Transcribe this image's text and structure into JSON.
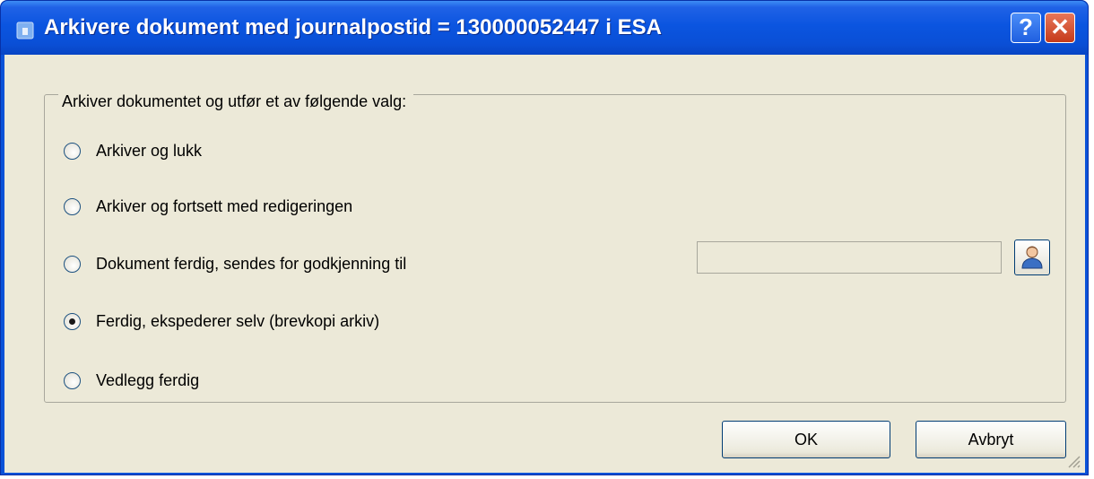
{
  "window": {
    "title": "Arkivere dokument med journalpostid = 130000052447 i ESA",
    "help_label": "?",
    "close_label": "✕"
  },
  "group": {
    "legend": "Arkiver dokumentet og utfør et av følgende valg:"
  },
  "options": [
    {
      "label": "Arkiver og lukk",
      "checked": false
    },
    {
      "label": "Arkiver og fortsett med redigeringen",
      "checked": false
    },
    {
      "label": "Dokument ferdig, sendes for godkjenning til",
      "checked": false
    },
    {
      "label": "Ferdig, ekspederer selv (brevkopi arkiv)",
      "checked": true
    },
    {
      "label": "Vedlegg ferdig",
      "checked": false
    }
  ],
  "approver": {
    "value": "",
    "button_icon": "person-icon"
  },
  "buttons": {
    "ok": "OK",
    "cancel": "Avbryt"
  },
  "colors": {
    "titlebar": "#0a52d8",
    "dialog_bg": "#ece9d8",
    "close_button": "#c53a1a"
  }
}
